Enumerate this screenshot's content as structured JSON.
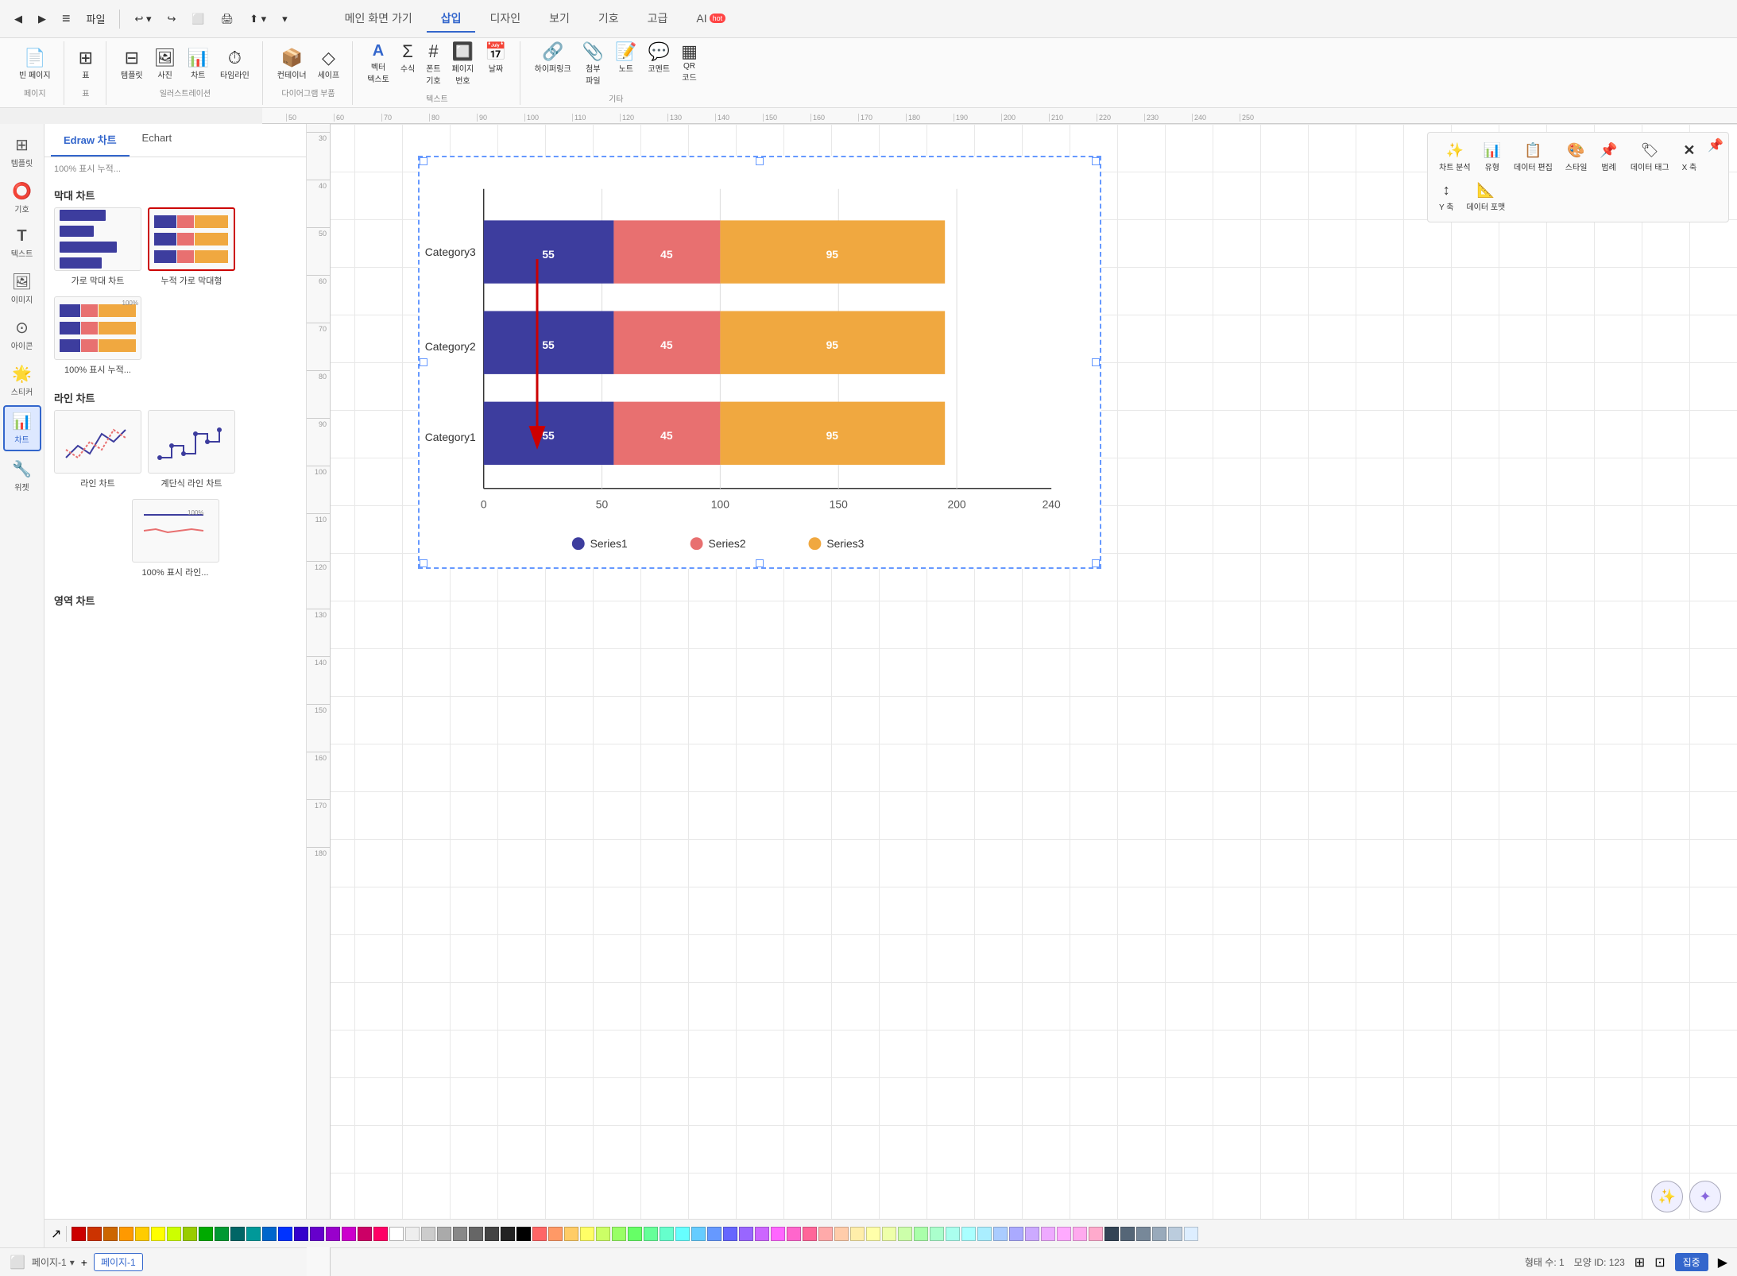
{
  "app": {
    "title": "Edraw"
  },
  "top_toolbar": {
    "back": "◀",
    "forward": "▶",
    "menu_icon": "≡",
    "file_label": "파일",
    "undo": "↩",
    "redo": "↪",
    "pages": "⬜",
    "print": "🖨",
    "share": "⬆"
  },
  "nav_tabs": [
    {
      "label": "메인 화면 가기",
      "active": false
    },
    {
      "label": "삽입",
      "active": true
    },
    {
      "label": "디자인",
      "active": false
    },
    {
      "label": "보기",
      "active": false
    },
    {
      "label": "기호",
      "active": false
    },
    {
      "label": "고급",
      "active": false
    },
    {
      "label": "AI",
      "active": false,
      "badge": "hot"
    }
  ],
  "toolbar_groups": [
    {
      "label": "페이지",
      "items": [
        {
          "icon": "📄",
          "label": "빈 페이지"
        }
      ]
    },
    {
      "label": "표",
      "items": [
        {
          "icon": "⊞",
          "label": "표"
        }
      ]
    },
    {
      "label": "일러스트레이션",
      "items": [
        {
          "icon": "⊟",
          "label": "템플릿"
        },
        {
          "icon": "🖼",
          "label": "사진"
        },
        {
          "icon": "📊",
          "label": "차트"
        },
        {
          "icon": "⏱",
          "label": "타임라인"
        }
      ]
    },
    {
      "label": "다이어그램 부품",
      "items": [
        {
          "icon": "📦",
          "label": "컨테이너"
        },
        {
          "icon": "◇",
          "label": "세이프"
        }
      ]
    },
    {
      "label": "텍스트",
      "items": [
        {
          "icon": "A",
          "label": "벡터\n텍스토"
        },
        {
          "icon": "Σ",
          "label": "수식"
        },
        {
          "icon": "#",
          "label": "폰트\n기호"
        },
        {
          "icon": "🔲",
          "label": "페이지\n번호"
        },
        {
          "icon": "📅",
          "label": "날짜"
        }
      ]
    },
    {
      "label": "기타",
      "items": [
        {
          "icon": "🔗",
          "label": "하이퍼링크"
        },
        {
          "icon": "📎",
          "label": "첨부\n파일"
        },
        {
          "icon": "📝",
          "label": "노트"
        },
        {
          "icon": "💬",
          "label": "코멘트"
        },
        {
          "icon": "▦",
          "label": "QR\n코드"
        }
      ]
    }
  ],
  "chart_panel": {
    "tabs": [
      {
        "label": "Edraw 차트",
        "active": true
      },
      {
        "label": "Echart",
        "active": false
      }
    ],
    "sections": [
      {
        "title": "막대 차트",
        "items": [
          {
            "label": "가로 막대 차트",
            "selected": false
          },
          {
            "label": "누적 가로 막대형",
            "selected": true
          }
        ]
      },
      {
        "title": "라인 차트",
        "items": [
          {
            "label": "라인 차트",
            "selected": false
          },
          {
            "label": "계단식 라인 차트",
            "selected": false
          }
        ]
      },
      {
        "title": "영역 차트",
        "items": []
      }
    ],
    "percent_labels": [
      "100% 표시 누적...",
      "100% 표시 누적...",
      "100% 표시 라인..."
    ]
  },
  "chart_data": {
    "title": "",
    "categories": [
      "Category3",
      "Category2",
      "Category1"
    ],
    "series": [
      {
        "name": "Series1",
        "color": "#3d3d9e",
        "values": [
          55,
          55,
          55
        ]
      },
      {
        "name": "Series2",
        "color": "#e87070",
        "values": [
          45,
          45,
          45
        ]
      },
      {
        "name": "Series3",
        "color": "#f0a840",
        "values": [
          95,
          95,
          95
        ]
      }
    ],
    "x_axis": [
      "0",
      "50",
      "100",
      "150",
      "200",
      "240"
    ]
  },
  "right_panel": {
    "buttons": [
      {
        "icon": "✨",
        "label": "차트 분석"
      },
      {
        "icon": "📊",
        "label": "유형"
      },
      {
        "icon": "📋",
        "label": "데이터 편집"
      },
      {
        "icon": "🎨",
        "label": "스타일"
      },
      {
        "icon": "📌",
        "label": "범례"
      },
      {
        "icon": "🏷",
        "label": "데이터 태그"
      },
      {
        "icon": "X",
        "label": "X 축"
      },
      {
        "icon": "↕",
        "label": "Y 축"
      },
      {
        "icon": "📐",
        "label": "데이터 포맷"
      }
    ]
  },
  "sidebar_items": [
    {
      "icon": "⊞",
      "label": "템플릿"
    },
    {
      "icon": "⭕",
      "label": "기호"
    },
    {
      "icon": "T",
      "label": "텍스트"
    },
    {
      "icon": "🖼",
      "label": "이미지"
    },
    {
      "icon": "⊙",
      "label": "아이콘"
    },
    {
      "icon": "🌟",
      "label": "스티커"
    },
    {
      "icon": "📊",
      "label": "차트",
      "active": true
    },
    {
      "icon": "🔧",
      "label": "위젯"
    }
  ],
  "bottom_bar": {
    "arrow_icon": "↗",
    "colors": [
      "#cc0000",
      "#cc3300",
      "#cc6600",
      "#ff9900",
      "#ffcc00",
      "#ffff00",
      "#ccff00",
      "#99cc00",
      "#00aa00",
      "#009933",
      "#006666",
      "#009999",
      "#0066cc",
      "#0033ff",
      "#3300cc",
      "#6600cc",
      "#9900cc",
      "#cc00cc",
      "#cc0066",
      "#ff0066",
      "#ffffff",
      "#eeeeee",
      "#cccccc",
      "#aaaaaa",
      "#888888",
      "#666666",
      "#444444",
      "#222222",
      "#000000",
      "#ff6666",
      "#ff9966",
      "#ffcc66",
      "#ffff66",
      "#ccff66",
      "#99ff66",
      "#66ff66",
      "#66ff99",
      "#66ffcc",
      "#66ffff",
      "#66ccff",
      "#6699ff",
      "#6666ff",
      "#9966ff",
      "#cc66ff",
      "#ff66ff",
      "#ff66cc",
      "#ff6699",
      "#ffaaaa",
      "#ffccaa",
      "#ffeeaa",
      "#ffffaa",
      "#eeffaa",
      "#ccffaa",
      "#aaffaa",
      "#aaffcc",
      "#aaffee",
      "#aaffff",
      "#aaeeff",
      "#aaccff",
      "#aaaaff",
      "#ccaaff",
      "#eeaaff",
      "#ffaaff",
      "#ffaaee",
      "#ffaacc",
      "#334455",
      "#556677",
      "#778899",
      "#99aabb",
      "#bbccdd",
      "#ddeeff"
    ]
  },
  "status_bar": {
    "page_name": "페이지-1",
    "add_page": "+",
    "page_tab_label": "페이지-1",
    "shape_count_label": "형태 수: 1",
    "shape_id_label": "모양 ID: 123",
    "layers_icon": "⊞",
    "fit_icon": "⊡",
    "focus_label": "집중",
    "play_icon": "▶"
  },
  "ruler": {
    "h_marks": [
      "50",
      "60",
      "70",
      "80",
      "90",
      "100",
      "110",
      "120",
      "130",
      "140",
      "150",
      "160",
      "170",
      "180",
      "190",
      "200",
      "210",
      "220",
      "230",
      "240",
      "250"
    ],
    "v_marks": [
      "30",
      "40",
      "50",
      "60",
      "70",
      "80",
      "90",
      "100",
      "110",
      "120",
      "130",
      "140",
      "150",
      "160",
      "170",
      "180"
    ]
  }
}
